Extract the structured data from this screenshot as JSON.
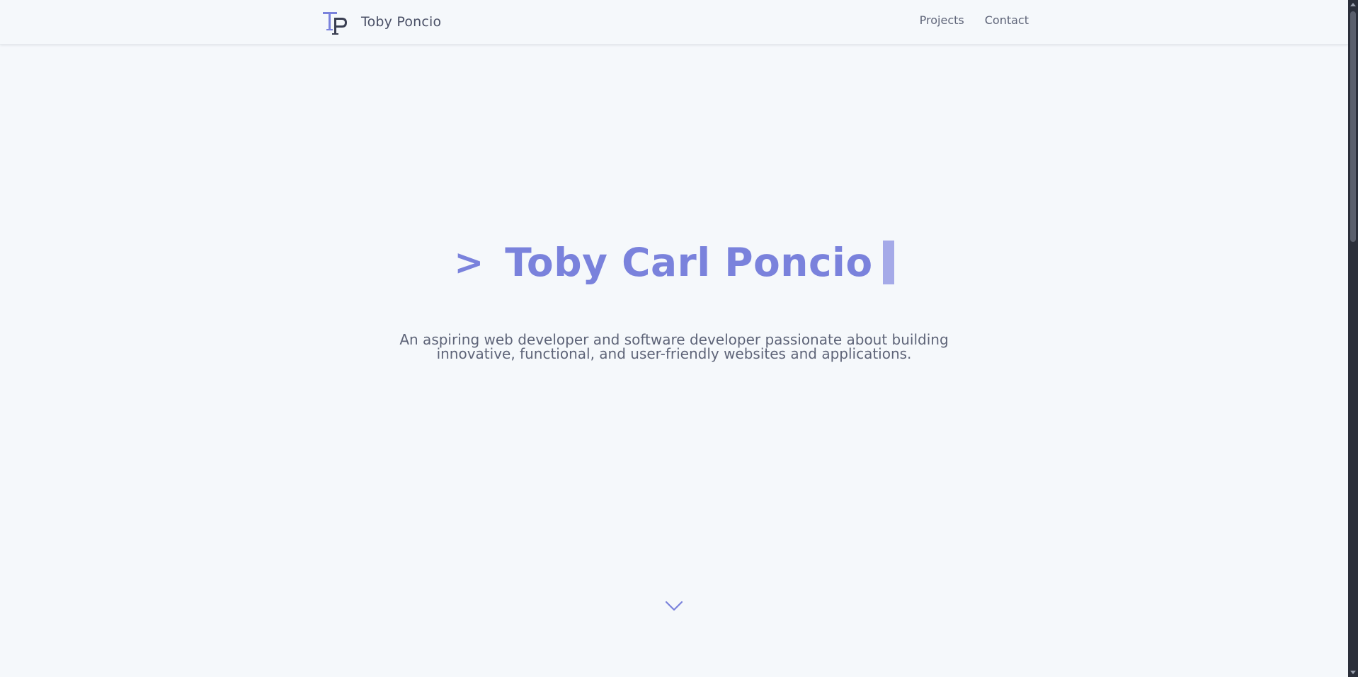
{
  "colors": {
    "background": "#f5f8fb",
    "accent": "#7a82dc",
    "cursor": "#a5aae8",
    "text": "#5e6478",
    "brand_text": "#4a5066"
  },
  "header": {
    "logo_icon": "tp-monogram-logo",
    "brand_name": "Toby Poncio",
    "nav": [
      {
        "label": "Projects"
      },
      {
        "label": "Contact"
      }
    ]
  },
  "hero": {
    "prompt": ">",
    "name": "Toby Carl Poncio",
    "tagline_line1": "An aspiring web developer and software developer passionate about building",
    "tagline_line2": "innovative, functional, and user-friendly websites and applications.",
    "scroll_icon": "chevron-down-icon"
  }
}
